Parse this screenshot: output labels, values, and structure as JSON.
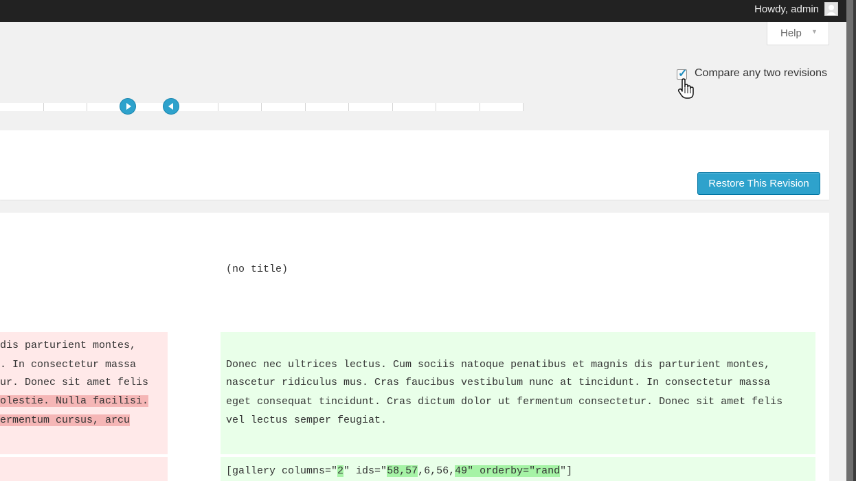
{
  "adminbar": {
    "greeting": "Howdy, admin"
  },
  "help": {
    "label": "Help",
    "caret": "▼"
  },
  "compare": {
    "label": "Compare any two revisions",
    "checked": true
  },
  "slider": {
    "handle_from_icon": "play-right-icon",
    "handle_to_icon": "play-left-icon"
  },
  "actions": {
    "restore_label": "Restore This Revision"
  },
  "diff": {
    "right_title": "(no title)",
    "left_content_lines": [
      {
        "text": "dis parturient montes,",
        "highlight": false
      },
      {
        "text": ". In consectetur massa",
        "highlight": false
      },
      {
        "text": "ur. Donec sit amet felis",
        "highlight": false
      },
      {
        "text": "olestie. Nulla facilisi.",
        "highlight": true
      },
      {
        "text": "ermentum cursus, arcu ",
        "highlight": true
      }
    ],
    "right_content_lines": [
      "Donec nec ultrices lectus. Cum sociis natoque penatibus et magnis dis parturient montes,",
      "nascetur ridiculus mus. Cras faucibus vestibulum nunc at tincidunt. In consectetur massa",
      "eget consequat tincidunt. Cras dictum dolor ut fermentum consectetur. Donec sit amet felis",
      "vel lectus semper feugiat."
    ],
    "gallery_line": {
      "p1": "[gallery columns=\"",
      "h1": "2",
      "p2": "\" ids=\"",
      "h2": "58,57",
      "p3": ",6,56,",
      "h3": "49\" orderby=\"rand",
      "p4": "\"]"
    }
  },
  "colors": {
    "accent": "#2ea2cc",
    "deleted_bg": "#ffe9e9",
    "deleted_highlight": "#f5b6b6",
    "added_bg": "#e9ffe9",
    "added_highlight": "#a6f3a6",
    "adminbar_bg": "#222222"
  }
}
